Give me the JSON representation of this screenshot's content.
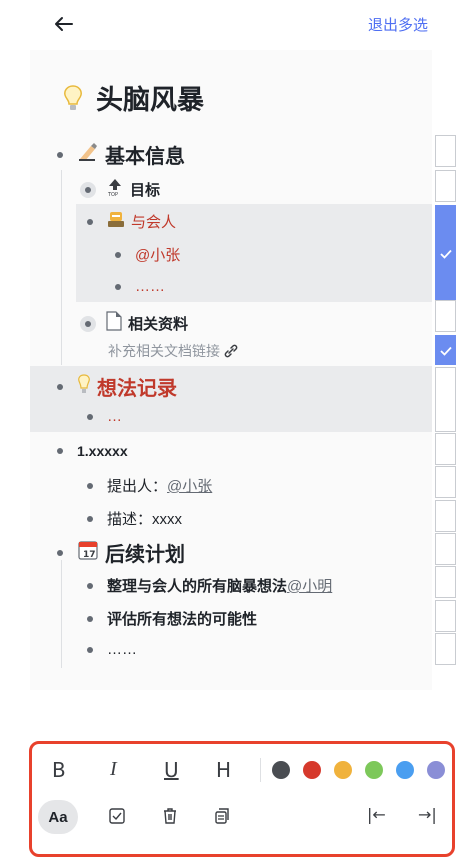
{
  "header": {
    "exit_label": "退出多选"
  },
  "doc": {
    "title": "头脑风暴",
    "sections": {
      "basic_info": "基本信息",
      "goal": "目标",
      "attendees": "与会人",
      "mention_zhang": "@小张",
      "ellipsis_red": "……",
      "related": "相关资料",
      "related_hint": "补充相关文档链接",
      "ideas": "想法记录",
      "ideas_ellipsis": "…",
      "item1": "1.xxxxx",
      "proposer_label": "提出人：",
      "proposer_name": "@小张",
      "desc": "描述：xxxx",
      "followup": "后续计划",
      "task1": "整理与会人的所有脑暴想法 ",
      "task1_mention": "@小明",
      "task2": "评估所有想法的可能性",
      "task3": "……"
    }
  },
  "toolbar": {
    "bold": "B",
    "italic": "I",
    "underline": "U",
    "heading": "H",
    "text_style": "Aa",
    "indent_left": "|←",
    "indent_right": "→|",
    "colors": [
      "#4a4d52",
      "#d6392c",
      "#f0b23c",
      "#7dc85a",
      "#4a9ef0",
      "#8a8ed6"
    ]
  },
  "checkboxes": [
    false,
    false,
    true,
    false,
    true,
    false,
    false,
    false,
    false
  ]
}
